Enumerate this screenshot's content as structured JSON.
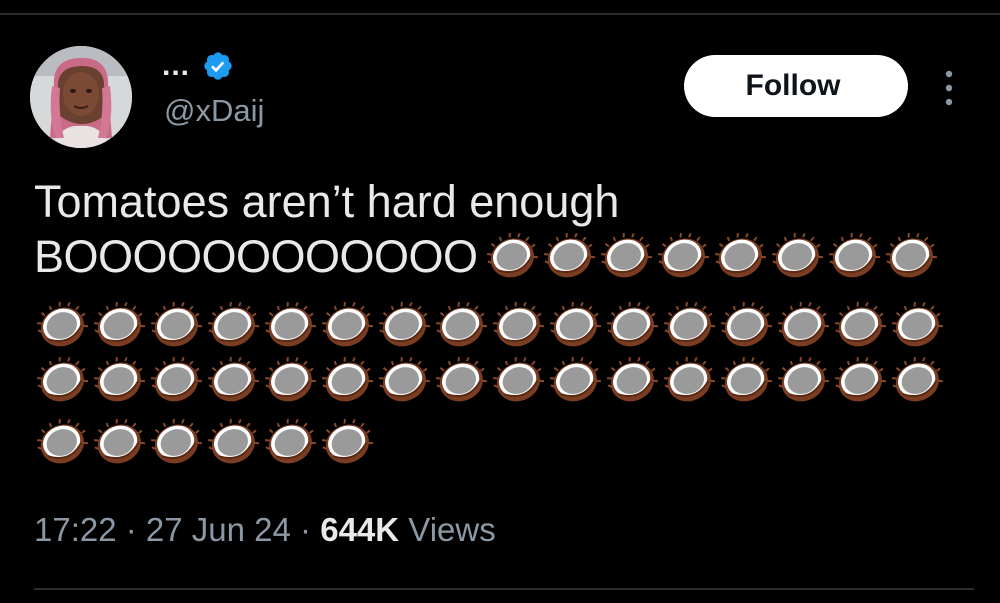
{
  "author": {
    "display_name": "...",
    "handle": "@xDaij",
    "verified_icon": "verified-badge-icon",
    "avatar": "profile-photo"
  },
  "follow_label": "Follow",
  "more_icon": "more-options-icon",
  "tweet": {
    "line1": "Tomatoes aren’t hard enough",
    "line2_text": "BOOOOOOOOOOOO",
    "emoji_icon": "coconut-emoji",
    "emoji_rows": [
      8,
      16,
      16,
      6
    ]
  },
  "meta": {
    "time": "17:22",
    "sep1": " · ",
    "date": "27 Jun 24",
    "sep2": " · ",
    "views_count": "644K",
    "views_label": " Views"
  },
  "colors": {
    "background": "#000000",
    "text": "#e7e9ea",
    "secondary": "#8b98a5",
    "verified": "#1d9bf0",
    "follow_bg": "#ffffff"
  }
}
